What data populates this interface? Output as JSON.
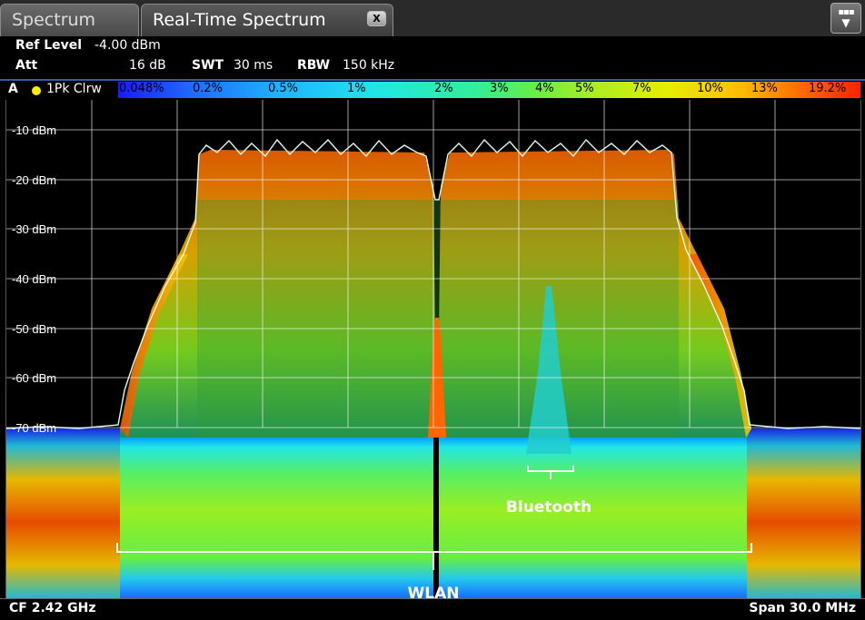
{
  "tabs": [
    {
      "label": "Spectrum"
    },
    {
      "label": "Real-Time Spectrum"
    }
  ],
  "tab_close_label": "X",
  "settings": {
    "ref_level_label": "Ref Level",
    "ref_level_value": "-4.00 dBm",
    "att_label": "Att",
    "att_value": "16 dB",
    "swt_label": "SWT",
    "swt_value": "30 ms",
    "rbw_label": "RBW",
    "rbw_value": "150 kHz"
  },
  "trace": {
    "window": "A",
    "mode": "1Pk Clrw",
    "indicator_color": "#ffee00"
  },
  "persistence_scale": [
    "0.048%",
    "0.2%",
    "0.5%",
    "1%",
    "2%",
    "3%",
    "4%",
    "5%",
    "7%",
    "10%",
    "13%",
    "19.2%"
  ],
  "y_ticks": [
    "-10 dBm",
    "-20 dBm",
    "-30 dBm",
    "-40 dBm",
    "-50 dBm",
    "-60 dBm",
    "-70 dBm"
  ],
  "annotations": {
    "bluetooth": "Bluetooth",
    "wlan": "WLAN"
  },
  "footer": {
    "center_freq": "CF 2.42 GHz",
    "span": "Span 30.0 MHz"
  },
  "colors": {
    "grid": "#ffffff",
    "accent_blue": "#2f5ea8"
  }
}
